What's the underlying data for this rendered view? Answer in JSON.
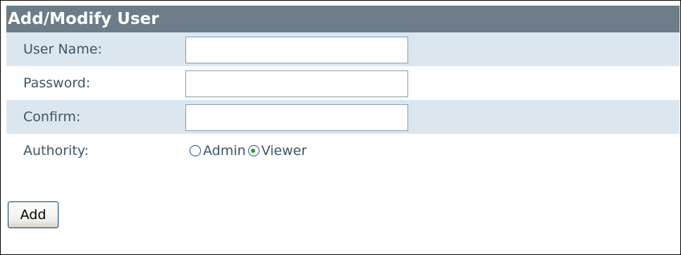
{
  "form": {
    "title": "Add/Modify User",
    "fields": [
      {
        "label": "User Name:",
        "value": "",
        "placeholder": ""
      },
      {
        "label": "Password:",
        "value": "",
        "placeholder": ""
      },
      {
        "label": "Confirm:",
        "value": "",
        "placeholder": ""
      }
    ],
    "authority": {
      "label": "Authority:",
      "options": [
        {
          "label": "Admin",
          "checked": false
        },
        {
          "label": "Viewer",
          "checked": true
        }
      ]
    },
    "add_label": "Add"
  },
  "colors": {
    "header_bg": "#6c7c89",
    "header_text": "#ffffff",
    "row_shade": "#dce6ee",
    "label_text": "#3e5566",
    "input_border": "#7f9db9",
    "radio_checked_dot": "#21a121"
  }
}
